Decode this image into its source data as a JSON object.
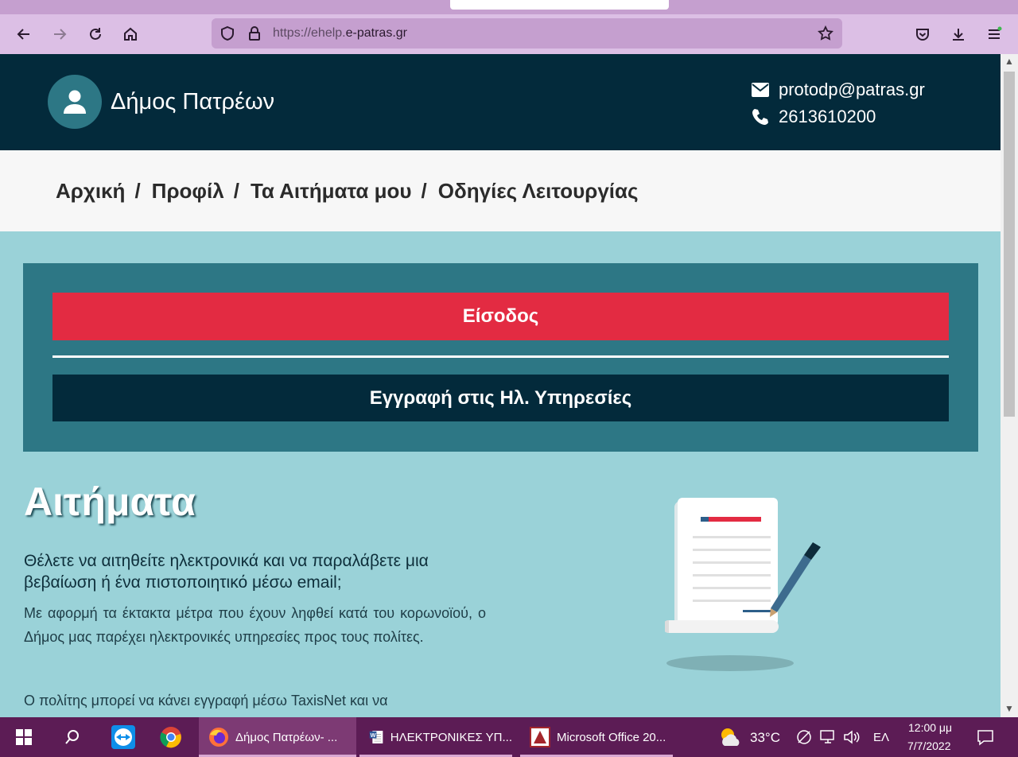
{
  "browser": {
    "url_prefix": "https://ehelp.",
    "url_domain": "e-patras.gr"
  },
  "site": {
    "name": "Δήμος Πατρέων",
    "email": "protodp@patras.gr",
    "phone": "2613610200"
  },
  "breadcrumb": [
    {
      "label": "Αρχική"
    },
    {
      "label": "Προφίλ"
    },
    {
      "label": "Τα Αιτήματα μου"
    },
    {
      "label": "Οδηγίες Λειτουργίας"
    }
  ],
  "breadcrumb_sep": "/",
  "auth": {
    "login_label": "Είσοδος",
    "register_label": "Εγγραφή στις Ηλ. Υπηρεσίες"
  },
  "content": {
    "heading": "Αιτήματα",
    "lead": "Θέλετε να αιτηθείτε ηλεκτρονικά και να παραλάβετε μια βεβαίωση ή ένα πιστοποιητικό μέσω email;",
    "para1": "Με αφορμή τα έκτακτα μέτρα που έχουν ληφθεί κατά του κορωνοϊού, ο Δήμος μας παρέχει ηλεκτρονικές υπηρεσίες προς τους πολίτες.",
    "para2": "Ο πολίτης  μπορεί να κάνει εγγραφή μέσω TaxisNet και να"
  },
  "taskbar": {
    "apps": [
      {
        "label": "Δήμος Πατρέων- ...",
        "icon": "firefox-icon",
        "active": true
      },
      {
        "label": "ΗΛΕΚΤΡΟΝΙΚΕΣ ΥΠ...",
        "icon": "word-icon",
        "active": false
      },
      {
        "label": "Microsoft Office 20...",
        "icon": "office-icon",
        "active": false
      }
    ],
    "weather": "33°C",
    "lang": "ΕΛ",
    "time": "12:00 μμ",
    "date": "7/7/2022"
  },
  "colors": {
    "header_bg": "#032a3b",
    "page_bg": "#9ad2d8",
    "panel_bg": "#2d7785",
    "login_bg": "#e32b42",
    "taskbar_bg": "#5c1c55",
    "browser_chrome": "#dcbfe5"
  }
}
